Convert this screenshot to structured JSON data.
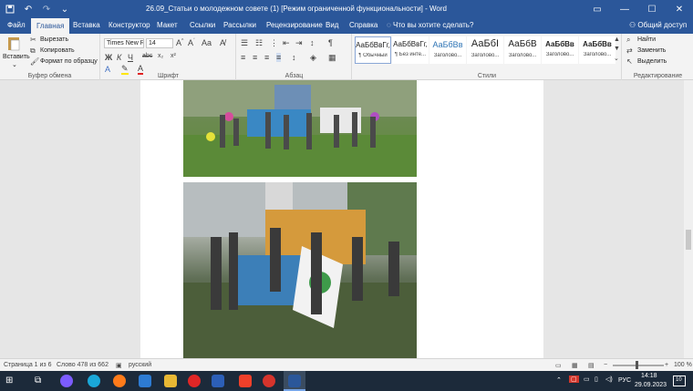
{
  "titlebar": {
    "title": "26.09_Статьи о молодежном совете (1) [Режим ограниченной функциональности]  -  Word",
    "icons": [
      "save-icon",
      "undo-icon",
      "redo-icon",
      "customize-icon"
    ],
    "win": [
      "ribbon-options-icon",
      "minimize-icon",
      "maximize-icon",
      "close-icon"
    ]
  },
  "tabs": [
    "Файл",
    "Главная",
    "Вставка",
    "Конструктор",
    "Макет",
    "Ссылки",
    "Рассылки",
    "Рецензирование",
    "Вид",
    "Справка"
  ],
  "tellme": "Что вы хотите сделать?",
  "share": "Общий доступ",
  "clipboard": {
    "paste": "Вставить",
    "cut": "Вырезать",
    "copy": "Копировать",
    "format": "Формат по образцу",
    "label": "Буфер обмена"
  },
  "font": {
    "name": "Times New R",
    "size": "14",
    "label": "Шрифт",
    "buttons": [
      "Ж",
      "К",
      "Ч",
      "abc",
      "x₂",
      "x²"
    ]
  },
  "paragraph": {
    "label": "Абзац"
  },
  "styles": {
    "label": "Стили",
    "items": [
      {
        "preview": "АаБбВвГг,",
        "name": "¶ Обычный"
      },
      {
        "preview": "АаБбВвГг,",
        "name": "¶ Без инте..."
      },
      {
        "preview": "АаБбВв",
        "name": "Заголово..."
      },
      {
        "preview": "АаБбI",
        "name": "Заголово..."
      },
      {
        "preview": "АаБбВ",
        "name": "Заголово..."
      },
      {
        "preview": "АаБбВв",
        "name": "Заголово..."
      },
      {
        "preview": "АаБбВв",
        "name": "Заголово..."
      }
    ]
  },
  "editing": {
    "find": "Найти",
    "replace": "Заменить",
    "select": "Выделить",
    "label": "Редактирование"
  },
  "statusbar": {
    "page": "Страница 1 из 6",
    "words": "Слово 478 из 662",
    "lang": "русский",
    "zoom": "100 %"
  },
  "taskbar": {
    "lang": "РУС",
    "time": "14:18",
    "date": "29.09.2023",
    "notif": "10",
    "app_icons": [
      "start-icon",
      "search-icon",
      "task-view-icon",
      "edge-icon",
      "firefox-icon",
      "explorer-icon",
      "files-icon",
      "yandex-icon",
      "gov-icon",
      "yandex-browser-icon",
      "app-icon",
      "word-icon"
    ]
  },
  "colors": {
    "accent": "#2b579a",
    "ribbon": "#f3f3f3",
    "canvas": "#e6e6e6"
  }
}
